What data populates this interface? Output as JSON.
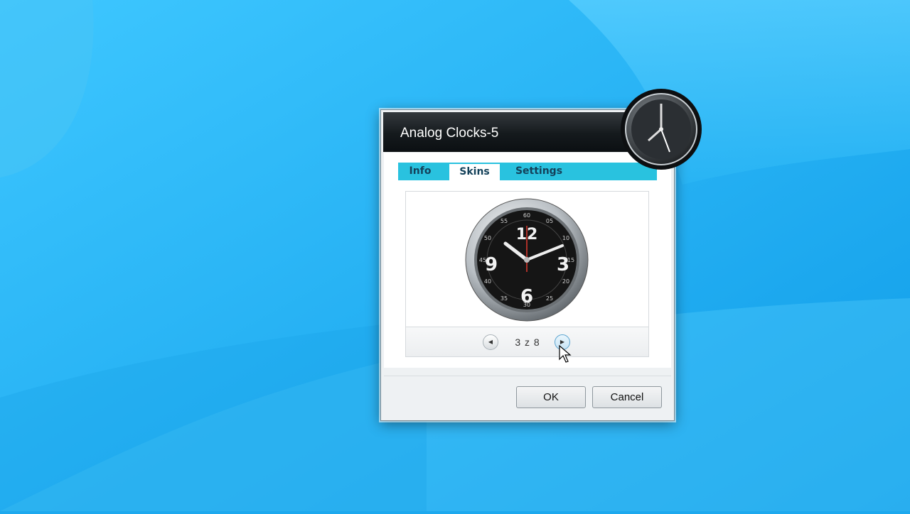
{
  "dialog": {
    "title": "Analog Clocks-5",
    "tabs": [
      {
        "label": "Info",
        "active": false
      },
      {
        "label": "Skins",
        "active": true
      },
      {
        "label": "Settings",
        "active": false
      }
    ],
    "skins": {
      "current_page": 3,
      "total_pages": 8,
      "page_indicator": "3 z 8",
      "prev_icon": "arrow-left-icon",
      "next_icon": "arrow-right-icon"
    },
    "buttons": {
      "ok_label": "OK",
      "cancel_label": "Cancel"
    }
  },
  "colors": {
    "desktop_background": "#1ea9ee",
    "tab_strip": "#29c2df",
    "titlebar": "#151a1d"
  }
}
